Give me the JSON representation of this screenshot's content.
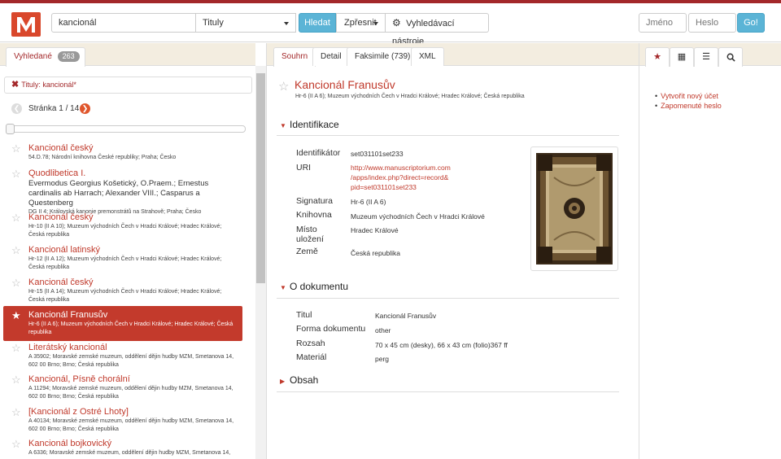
{
  "header": {
    "search_value": "kancionál",
    "search_field": "Tituly",
    "search_button": "Hledat",
    "refine_button": "Zpřesnit",
    "tools_button": "Vyhledávací nástroje",
    "username_placeholder": "Jméno",
    "password_placeholder": "Heslo",
    "go_button": "Go!"
  },
  "left": {
    "tab_label": "Vyhledané",
    "tab_count": "263",
    "filter": "Tituly: kancionál*",
    "page_text": "Stránka 1 / 14",
    "items": [
      {
        "title": "Kancionál český",
        "author": "",
        "meta": "54.D.78; Národní knihovna České republiky; Praha; Česko"
      },
      {
        "title": "Quodlibetica I.",
        "author": "Evermodus Georgius Košetický, O.Praem.; Ernestus cardinalis ab Harrach; Alexander VIII.; Casparus a Questenberg",
        "meta": "DG II 4; Královská kanonie premonstrátů na Strahově; Praha; Česko"
      },
      {
        "title": "Kancionál český",
        "author": "",
        "meta": "Hr-10 (II A 10); Muzeum východních Čech v Hradci Králové; Hradec Králové; Česká republika"
      },
      {
        "title": "Kancionál latinský",
        "author": "",
        "meta": "Hr-12 (II A 12); Muzeum východních Čech v Hradci Králové; Hradec Králové; Česká republika"
      },
      {
        "title": "Kancionál český",
        "author": "",
        "meta": "Hr-15 (II A 14); Muzeum východních Čech v Hradci Králové; Hradec Králové; Česká republika"
      },
      {
        "title": "Kancionál Franusův",
        "author": "",
        "meta": "Hr-6 (II A 6); Muzeum východních Čech v Hradci Králové; Hradec Králové; Česká republika"
      },
      {
        "title": "Literátský kancionál",
        "author": "",
        "meta": "A 35902; Moravské zemské muzeum, oddělení dějin hudby MZM, Smetanova 14, 602 00 Brno; Brno; Česká republika"
      },
      {
        "title": "Kancionál, Písně chorální",
        "author": "",
        "meta": "A 11294; Moravské zemské muzeum, oddělení dějin hudby MZM, Smetanova 14, 602 00 Brno; Brno; Česká republika"
      },
      {
        "title": "[Kancionál z Ostré Lhoty]",
        "author": "",
        "meta": "A 40134; Moravské zemské muzeum, oddělení dějin hudby MZM, Smetanova 14, 602 00 Brno; Brno; Česká republika"
      },
      {
        "title": "Kancionál bojkovický",
        "author": "",
        "meta": "A 6336; Moravské zemské muzeum, oddělení dějin hudby MZM, Smetanova 14,"
      }
    ]
  },
  "main": {
    "tabs": [
      "Souhrn",
      "Detail",
      "Faksimile (739)",
      "XML"
    ],
    "title": "Kancionál Franusův",
    "subtitle": "Hr-6 (II A 6); Muzeum východních Čech v Hradci Králové; Hradec Králové; Česká republika",
    "identification": {
      "heading": "Identifikace",
      "identifier_label": "Identifikátor",
      "identifier": "set031101set233",
      "uri_label": "URI",
      "uri_line1": "http://www.manuscriptorium.com",
      "uri_line2": "/apps/index.php?direct=record&",
      "uri_line3": "pid=set031101set233",
      "signature_label": "Signatura",
      "signature": "Hr-6 (II A 6)",
      "library_label": "Knihovna",
      "library": "Muzeum východních Čech v Hradci Králové",
      "place_label_1": "Místo",
      "place_label_2": "uložení",
      "place": "Hradec Králové",
      "country_label": "Země",
      "country": "Česká republika"
    },
    "document": {
      "heading": "O dokumentu",
      "title_label": "Titul",
      "title": "Kancionál Franusův",
      "form_label": "Forma dokumentu",
      "form": "other",
      "extent_label": "Rozsah",
      "extent": "70 x 45 cm (desky), 66 x 43 cm (folio)367 ff",
      "material_label": "Materiál",
      "material": "perg"
    },
    "content": {
      "heading": "Obsah"
    }
  },
  "right": {
    "links": [
      "Vytvořit nový účet",
      "Zapomenuté heslo"
    ]
  },
  "colors": {
    "accent": "#a3282a",
    "link": "#c0392b",
    "button_blue": "#5bb4d6",
    "selected": "#c33a2c",
    "paper": "#f3ede0"
  }
}
